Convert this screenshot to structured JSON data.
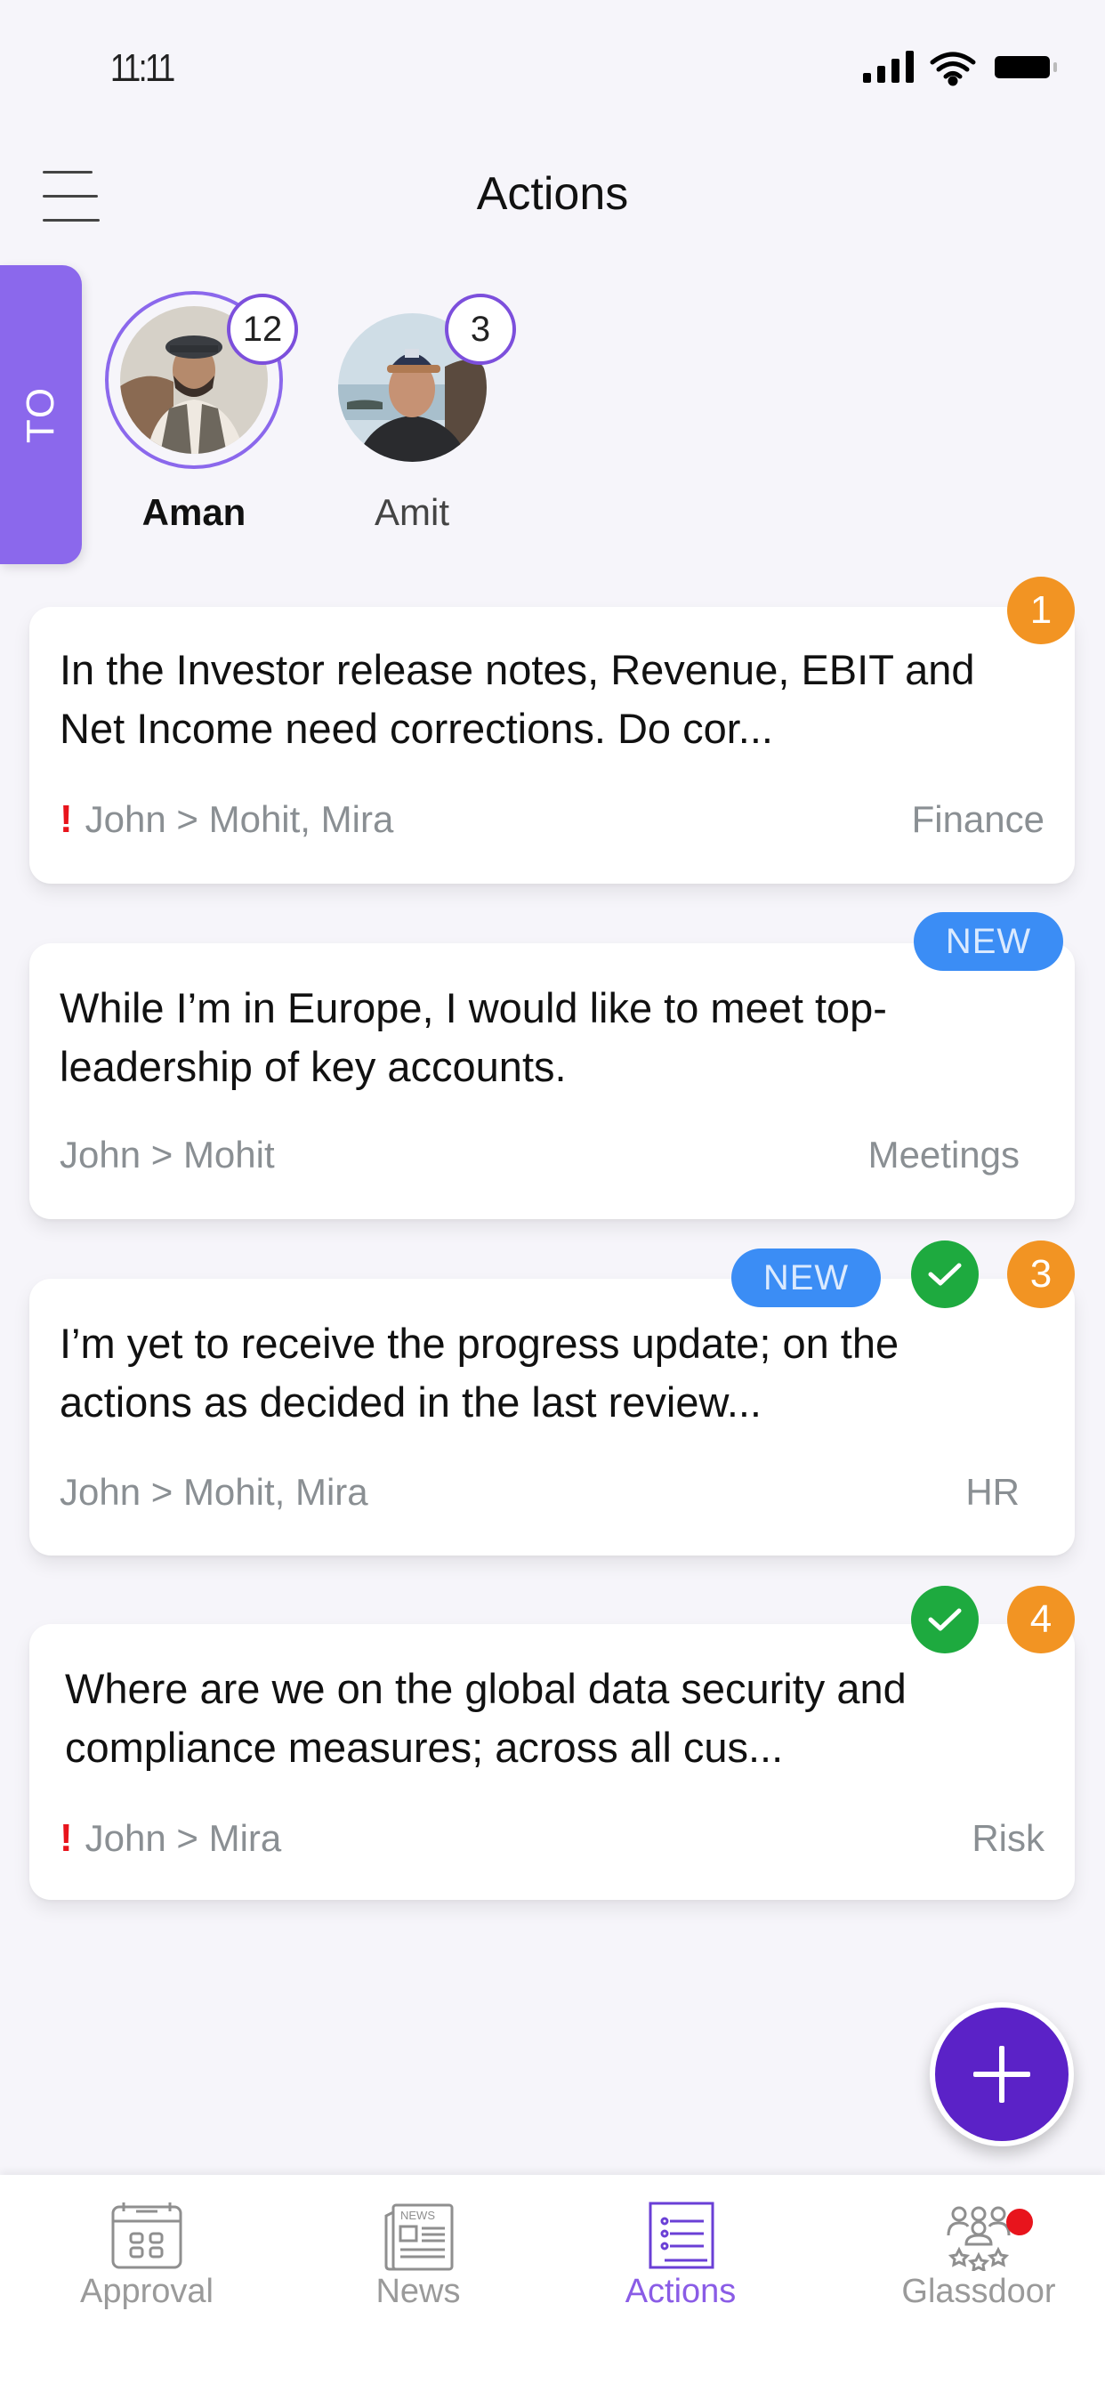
{
  "status_bar": {
    "time": "11:11",
    "icons": [
      "signal-icon",
      "wifi-icon",
      "battery-icon"
    ]
  },
  "header": {
    "title": "Actions",
    "menu_icon": "hamburger-menu-icon"
  },
  "direction_tab": {
    "label": "TO"
  },
  "people": [
    {
      "name": "Aman",
      "count": "12",
      "selected": true
    },
    {
      "name": "Amit",
      "count": "3",
      "selected": false
    }
  ],
  "cards": [
    {
      "text": "In the Investor release notes, Revenue, EBIT and Net Income need corrections. Do cor...",
      "priority_mark": "!",
      "high_priority": true,
      "route": "John > Mohit, Mira",
      "category": "Finance",
      "new": false,
      "completed": false,
      "number": "1"
    },
    {
      "text": "While I’m in Europe, I would like to meet top-leadership of key accounts.",
      "priority_mark": "",
      "high_priority": false,
      "route": "John > Mohit",
      "category": "Meetings",
      "new": true,
      "new_label": "NEW",
      "completed": false,
      "number": ""
    },
    {
      "text": "I’m yet to receive the progress update; on the actions as decided in the last review...",
      "priority_mark": "",
      "high_priority": false,
      "route": "John > Mohit, Mira",
      "category": "HR",
      "new": true,
      "new_label": "NEW",
      "completed": true,
      "number": "3"
    },
    {
      "text": "Where are we on the global data security and compliance measures; across all cus...",
      "priority_mark": "!",
      "high_priority": true,
      "route": "John > Mira",
      "category": "Risk",
      "new": false,
      "completed": true,
      "number": "4"
    }
  ],
  "fab": {
    "icon": "plus-icon",
    "action": "add-action"
  },
  "bottom_nav": {
    "items": [
      {
        "label": "Approval",
        "icon": "calendar-grid-icon",
        "active": false,
        "notification": false
      },
      {
        "label": "News",
        "icon": "newspaper-icon",
        "active": false,
        "notification": false
      },
      {
        "label": "Actions",
        "icon": "checklist-icon",
        "active": true,
        "notification": false
      },
      {
        "label": "Glassdoor",
        "icon": "team-rating-icon",
        "active": false,
        "notification": true
      }
    ]
  },
  "colors": {
    "accent_purple": "#8b68ec",
    "fab_purple": "#5b22c7",
    "badge_orange": "#f29423",
    "badge_green": "#1eaa3f",
    "badge_blue": "#3b8df5",
    "priority_red": "#e8141c"
  }
}
